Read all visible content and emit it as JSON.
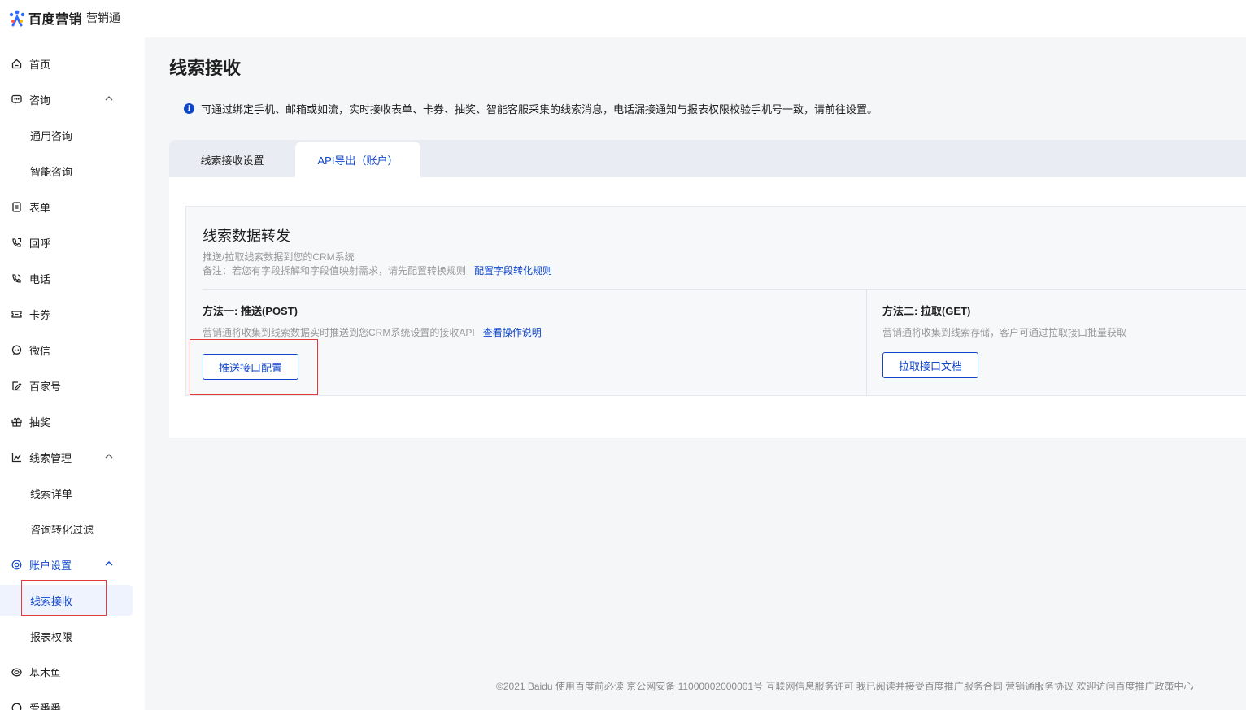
{
  "logo": {
    "brand": "百度营销",
    "product": "营销通"
  },
  "sidebar": {
    "items": [
      {
        "label": "首页",
        "icon": "home-icon"
      },
      {
        "label": "咨询",
        "icon": "chat-icon",
        "expanded": true
      },
      {
        "label": "通用咨询"
      },
      {
        "label": "智能咨询"
      },
      {
        "label": "表单",
        "icon": "form-icon"
      },
      {
        "label": "回呼",
        "icon": "callback-icon"
      },
      {
        "label": "电话",
        "icon": "phone-icon"
      },
      {
        "label": "卡券",
        "icon": "coupon-icon"
      },
      {
        "label": "微信",
        "icon": "wechat-icon"
      },
      {
        "label": "百家号",
        "icon": "baijiahao-icon"
      },
      {
        "label": "抽奖",
        "icon": "gift-icon"
      },
      {
        "label": "线索管理",
        "icon": "chart-icon",
        "expanded": true
      },
      {
        "label": "线索详单"
      },
      {
        "label": "咨询转化过滤"
      },
      {
        "label": "账户设置",
        "icon": "settings-icon",
        "expanded": true
      },
      {
        "label": "线索接收",
        "active": true
      },
      {
        "label": "报表权限"
      },
      {
        "label": "基木鱼",
        "icon": "jimuyu-icon"
      },
      {
        "label": "爱番番",
        "icon": "aifanfan-icon"
      }
    ]
  },
  "page": {
    "title": "线索接收",
    "notice": "可通过绑定手机、邮箱或如流，实时接收表单、卡券、抽奖、智能客服采集的线索消息，电话漏接通知与报表权限校验手机号一致，请前往设置。"
  },
  "tabs": [
    {
      "label": "线索接收设置"
    },
    {
      "label": "API导出（账户）",
      "active": true
    }
  ],
  "card": {
    "title": "线索数据转发",
    "desc1": "推送/拉取线索数据到您的CRM系统",
    "desc2": "备注：若您有字段拆解和字段值映射需求，请先配置转换规则",
    "desc2_link": "配置字段转化规则",
    "method1": {
      "title": "方法一: 推送(POST)",
      "desc": "营销通将收集到线索数据实时推送到您CRM系统设置的接收API",
      "link": "查看操作说明",
      "button": "推送接口配置"
    },
    "method2": {
      "title": "方法二: 拉取(GET)",
      "desc": "营销通将收集到线索存储，客户可通过拉取接口批量获取",
      "button": "拉取接口文档"
    }
  },
  "footer": "©2021  Baidu 使用百度前必读 京公网安备 11000002000001号 互联网信息服务许可 我已阅读并接受百度推广服务合同 营销通服务协议 欢迎访问百度推广政策中心",
  "colors": {
    "accent": "#0f46c8",
    "highlight": "#e53935"
  }
}
